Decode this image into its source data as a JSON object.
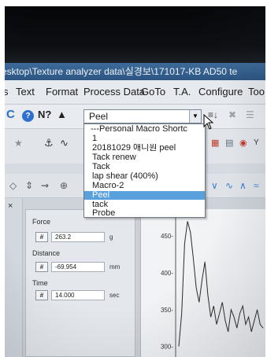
{
  "window": {
    "title": "esktop\\Texture analyzer data\\실경보\\171017-KB AD50 te"
  },
  "menubar": {
    "items": [
      "s",
      "Text",
      "Format",
      "Process Data",
      "GoTo",
      "T.A.",
      "Configure",
      "Too"
    ]
  },
  "toolbar": {
    "icons": [
      "refresh-icon",
      "help-icon",
      "whats-this-icon",
      "graduation-icon"
    ],
    "macro_combo": {
      "value": "Peel"
    }
  },
  "macro_dropdown": {
    "header": "---Personal Macro Shortc",
    "items": [
      "1",
      "20181029 애니원 peel",
      "Tack renew",
      "Tack",
      "lap shear (400%)",
      "Macro-2",
      "Peel",
      "tack",
      "Probe"
    ],
    "selected_index": 6
  },
  "readout": {
    "fields": [
      {
        "label": "Force",
        "value": "263.2",
        "unit": "g"
      },
      {
        "label": "Distance",
        "value": "-69.954",
        "unit": "mm"
      },
      {
        "label": "Time",
        "value": "14.000",
        "unit": "sec"
      }
    ],
    "field_button": "#"
  },
  "chart_data": {
    "type": "line",
    "ytick_labels": [
      "450-",
      "400-",
      "350-",
      "300-"
    ],
    "ylim": [
      290,
      480
    ],
    "grid": false,
    "series": [
      {
        "x": [
          0,
          1,
          2,
          3,
          4,
          5,
          6,
          7,
          8,
          9,
          10,
          11,
          12,
          13,
          14,
          15,
          16,
          17,
          18,
          19,
          20,
          21,
          22,
          23,
          24,
          25,
          26,
          27,
          28,
          29
        ],
        "y": [
          300,
          345,
          440,
          470,
          455,
          420,
          380,
          360,
          390,
          415,
          370,
          340,
          355,
          330,
          345,
          360,
          335,
          320,
          350,
          340,
          325,
          345,
          355,
          330,
          340,
          320,
          335,
          350,
          330,
          325
        ]
      }
    ]
  },
  "colors": {
    "titlebar": "#2c5582",
    "selection": "#5aa0dc",
    "background": "#e6e9ed"
  }
}
